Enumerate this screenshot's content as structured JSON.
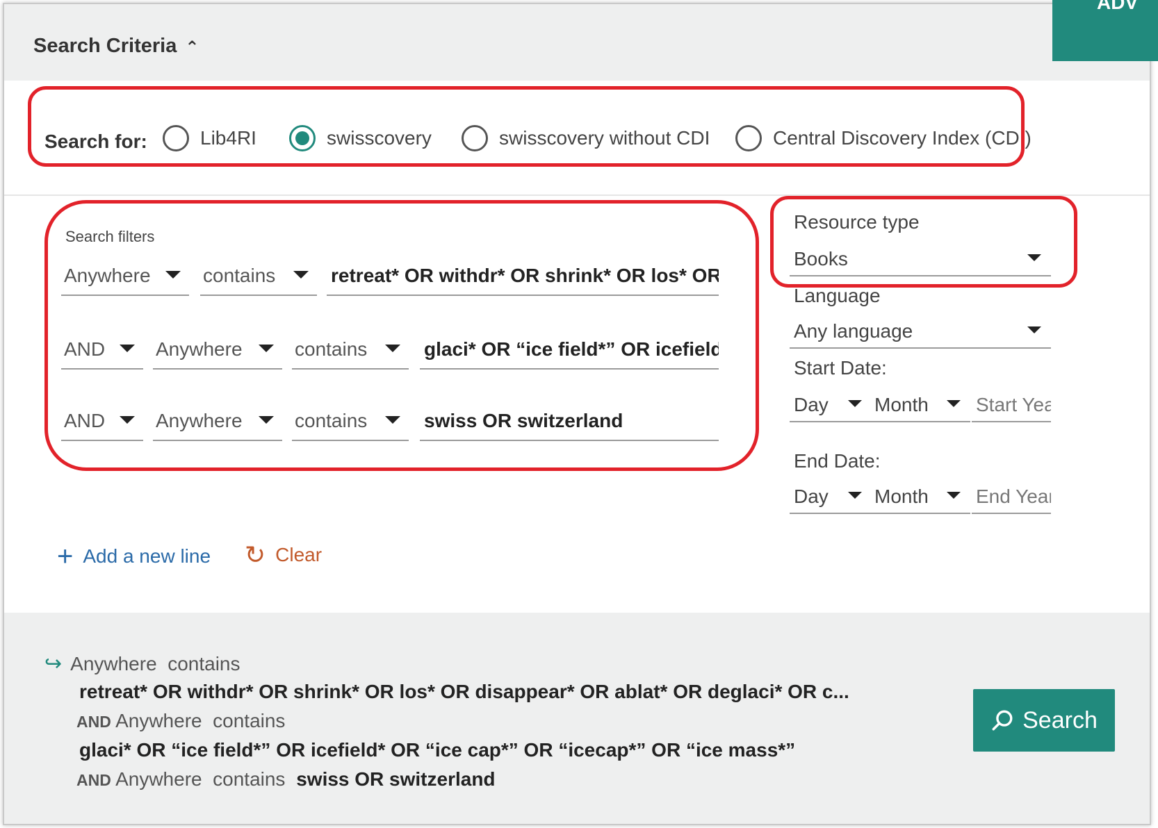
{
  "header": {
    "title": "Search Criteria",
    "advanced_label": "ADV"
  },
  "search_for": {
    "label": "Search for:",
    "options": [
      "Lib4RI",
      "swisscovery",
      "swisscovery without CDI",
      "Central Discovery Index (CDI)"
    ],
    "selected": "swisscovery"
  },
  "filters": {
    "label": "Search filters",
    "rows": [
      {
        "operator": "",
        "field": "Anywhere",
        "condition": "contains",
        "query": "retreat* OR withdr* OR shrink* OR los* OR disa"
      },
      {
        "operator": "AND",
        "field": "Anywhere",
        "condition": "contains",
        "query": "glaci* OR “ice field*” OR icefield* O"
      },
      {
        "operator": "AND",
        "field": "Anywhere",
        "condition": "contains",
        "query": "swiss OR switzerland"
      }
    ],
    "add_line_label": "Add a new line",
    "clear_label": "Clear"
  },
  "sidebar": {
    "resource_type": {
      "label": "Resource type",
      "value": "Books"
    },
    "language": {
      "label": "Language",
      "value": "Any language"
    },
    "start_date": {
      "label": "Start Date:",
      "day": "Day",
      "month": "Month",
      "year_placeholder": "Start Year"
    },
    "end_date": {
      "label": "End Date:",
      "day": "Day",
      "month": "Month",
      "year_placeholder": "End Year"
    }
  },
  "summary": {
    "line1_prefix": "Anywhere  contains",
    "line1_query": "retreat* OR withdr* OR shrink* OR los* OR disappear* OR ablat* OR deglaci* OR c...",
    "line2_op": "AND",
    "line2_prefix": "Anywhere  contains",
    "line2_query": "glaci* OR “ice field*” OR icefield* OR “ice cap*” OR “icecap*” OR “ice mass*”",
    "line3_op": "AND",
    "line3_prefix": "Anywhere  contains",
    "line3_query": "swiss OR switzerland"
  },
  "search_button_label": "Search",
  "colors": {
    "accent": "#218a7d",
    "highlight": "#e2222a",
    "link": "#2a6aa8",
    "clear": "#c25a2b"
  }
}
